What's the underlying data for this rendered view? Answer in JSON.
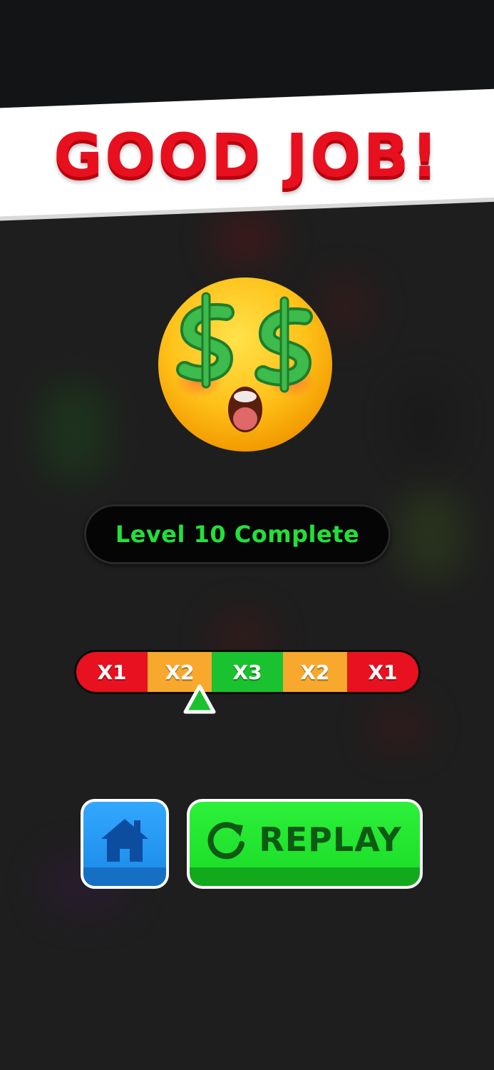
{
  "banner": {
    "title": "GOOD JOB!"
  },
  "result": {
    "level_text": "Level 10 Complete"
  },
  "multiplier": {
    "segments": [
      {
        "label": "X1",
        "color": "#e8111f"
      },
      {
        "label": "X2",
        "color": "#f8a82c"
      },
      {
        "label": "X3",
        "color": "#19c22e"
      },
      {
        "label": "X2",
        "color": "#f8a82c"
      },
      {
        "label": "X1",
        "color": "#e8111f"
      }
    ],
    "pointer_segment": "X2"
  },
  "buttons": {
    "home_icon": "home-icon",
    "replay_icon": "replay-icon",
    "replay_label": "REPLAY"
  },
  "colors": {
    "title_red": "#e8101f",
    "level_green": "#22e03a",
    "replay_green": "#1ee02a",
    "home_blue": "#1f8fec"
  },
  "emoji": "money-mouth-emoji"
}
